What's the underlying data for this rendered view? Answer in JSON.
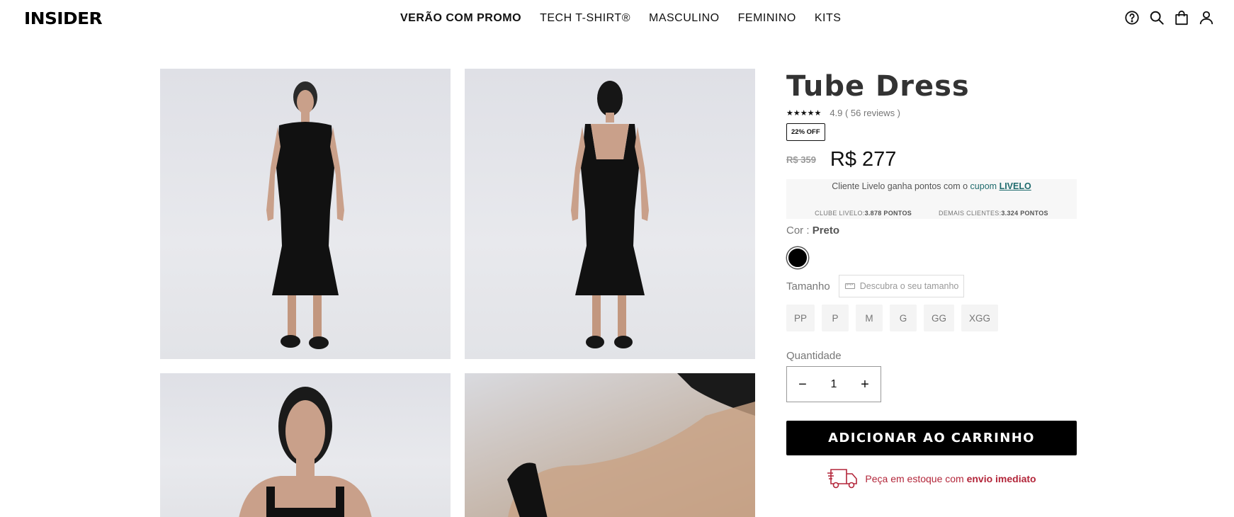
{
  "header": {
    "logo": "INSIDER",
    "nav": [
      {
        "label": "VERÃO COM PROMO",
        "bold": true
      },
      {
        "label": "TECH T-SHIRT®",
        "bold": false
      },
      {
        "label": "MASCULINO",
        "bold": false
      },
      {
        "label": "FEMININO",
        "bold": false
      },
      {
        "label": "KITS",
        "bold": false
      }
    ],
    "icons": [
      "help-icon",
      "search-icon",
      "bag-icon",
      "user-icon"
    ]
  },
  "gallery": {
    "images": [
      "dress-front-photo",
      "dress-back-photo",
      "dress-portrait-photo",
      "dress-shoulder-detail-photo"
    ]
  },
  "product": {
    "title": "Tube Dress",
    "stars": "★★★★★",
    "rating": "4.9 ( 56 reviews )",
    "discount": "22% OFF",
    "old_price": "R$ 359",
    "new_price": "R$ 277",
    "livelo": {
      "text_pre": "Cliente Livelo ganha pontos com o",
      "text_cupom": "cupom",
      "code": "LIVELO",
      "clube_label": "CLUBE LIVELO:",
      "clube_points": "3.878 PONTOS",
      "demais_label": "DEMAIS CLIENTES:",
      "demais_points": "3.324 PONTOS"
    },
    "cor_label": "Cor :",
    "cor_value": "Preto",
    "swatch_color": "#000000",
    "tamanho_label": "Tamanho",
    "find_size": "Descubra o seu tamanho",
    "sizes": [
      "PP",
      "P",
      "M",
      "G",
      "GG",
      "XGG"
    ],
    "quantity_label": "Quantidade",
    "quantity_minus": "−",
    "quantity_value": "1",
    "quantity_plus": "+",
    "add_to_cart": "ADICIONAR AO CARRINHO",
    "stock_text": "Peça em estoque com",
    "stock_bold": "envio imediato"
  },
  "colors": {
    "accent_red": "#b3263a",
    "livelo_teal": "#1f6b6d"
  }
}
